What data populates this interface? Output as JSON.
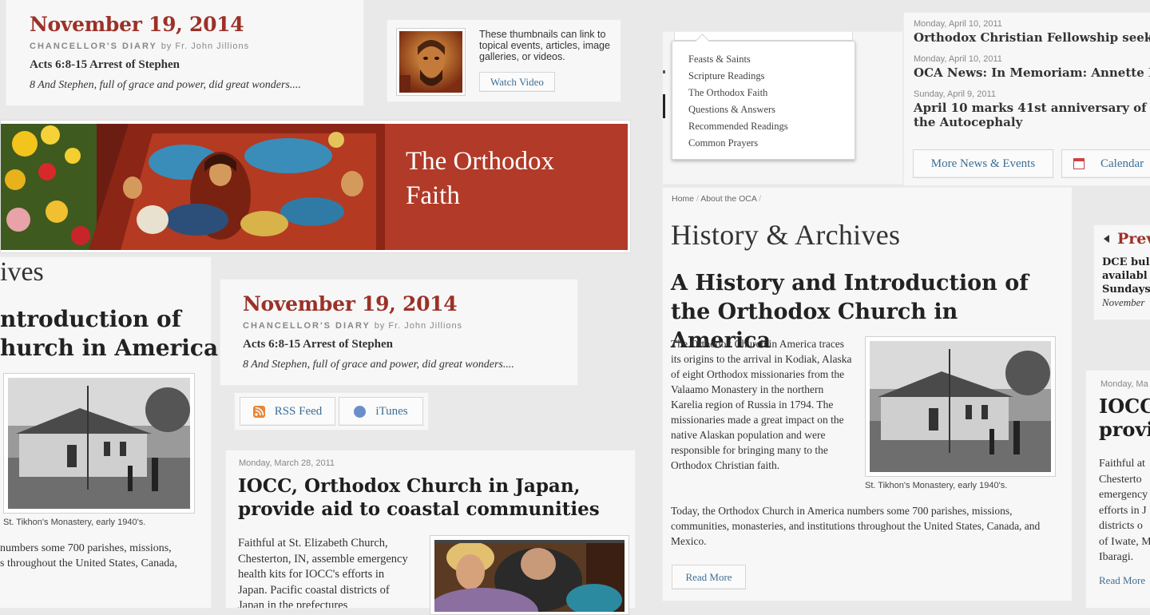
{
  "diary_a": {
    "date": "November 19, 2014",
    "label": "CHANCELLOR'S DIARY",
    "by": "by Fr. John Jillions",
    "title": "Acts 6:8-15 Arrest of Stephen",
    "excerpt": "8 And Stephen, full of grace and power, did great wonders...."
  },
  "thumb_card": {
    "text": "These thumbnails can link to topical events, articles, image galleries, or videos.",
    "button": "Watch Video"
  },
  "dropdown": {
    "items": [
      "Feasts & Saints",
      "Scripture Readings",
      "The Orthodox Faith",
      "Questions & Answers",
      "Recommended Readings",
      "Common Prayers"
    ]
  },
  "news": {
    "items": [
      {
        "date": "Monday, April 10, 2011",
        "title": "Orthodox Christian Fellowship seeks e"
      },
      {
        "date": "Monday, April 10, 2011",
        "title": "OCA News: In Memoriam: Annette Milko"
      },
      {
        "date": "Sunday, April 9, 2011",
        "title": "April 10 marks 41st anniversary of the Autocephaly"
      }
    ],
    "more_button": "More News & Events",
    "calendar_button": "Calendar"
  },
  "banner": {
    "title_line1": "The Orthodox",
    "title_line2": "Faith"
  },
  "left_partial": {
    "heading_fragment": "ives",
    "article_line1": "ntroduction of",
    "article_line2": "hurch in America",
    "caption": "St. Tikhon's Monastery, early 1940's.",
    "text_line1": "numbers some 700 parishes, missions,",
    "text_line2": "s throughout the United States, Canada,"
  },
  "diary_b": {
    "date": "November 19, 2014",
    "label": "CHANCELLOR'S DIARY",
    "by": "by Fr. John Jillions",
    "title": "Acts 6:8-15 Arrest of Stephen",
    "excerpt": "8 And Stephen, full of grace and power, did great wonders...."
  },
  "feeds": {
    "rss": "RSS Feed",
    "itunes": "iTunes"
  },
  "iocc_main": {
    "date": "Monday, March 28, 2011",
    "title": "IOCC, Orthodox Church in Japan, provide aid to coastal communities",
    "body": "Faithful at St. Elizabeth Church, Chesterton, IN, assemble emergency health kits for IOCC's efforts in Japan. Pacific coastal districts of Japan in the prefectures"
  },
  "history": {
    "breadcrumb": [
      "Home",
      "About the OCA"
    ],
    "page_title": "History & Archives",
    "article_title": "A History and Introduction of the Orthodox Church in America",
    "para1": "The Orthodox Church in America traces its origins to the arrival in Kodiak, Alaska of eight Orthodox missionaries from the Valaamo Monastery in the northern Karelia region of Russia in 1794. The missionaries made a great impact on the native Alaskan population and were responsible for bringing many to the Orthodox Christian faith.",
    "para2": "Today, the Orthodox Church in America numbers some 700 parishes, missions, communities, monasteries, and institutions throughout the United States, Canada, and Mexico.",
    "caption": "St. Tikhon's Monastery, early 1940's.",
    "read_more": "Read More"
  },
  "prev_panel": {
    "label": "Prev",
    "lines": [
      "DCE bull",
      "availabl",
      "Sundays"
    ],
    "date": "November"
  },
  "iocc_right": {
    "date": "Monday, Ma",
    "title_line1": "IOCC",
    "title_line2": "provi",
    "lines": [
      "Faithful at",
      "Chesterto",
      "emergency",
      "efforts in J",
      "districts o",
      "of Iwate, M",
      "Ibaragi."
    ],
    "read_more": "Read More"
  },
  "colors": {
    "accent_red": "#9b3128",
    "link_blue": "#3d6e95",
    "banner_red": "#b23a28"
  }
}
